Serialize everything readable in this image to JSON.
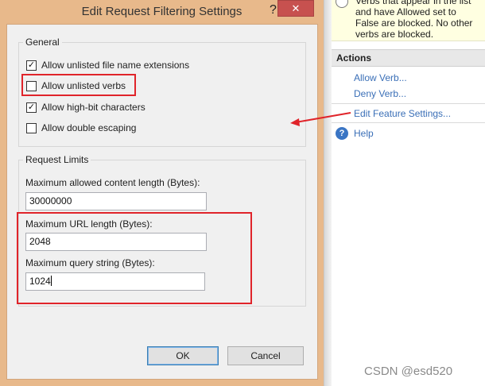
{
  "dialog": {
    "title": "Edit Request Filtering Settings",
    "help_glyph": "?",
    "close_glyph": "✕",
    "general": {
      "legend": "General",
      "options": [
        {
          "label": "Allow unlisted file name extensions",
          "checked": true
        },
        {
          "label": "Allow unlisted verbs",
          "checked": false
        },
        {
          "label": "Allow high-bit characters",
          "checked": true
        },
        {
          "label": "Allow double escaping",
          "checked": false
        }
      ]
    },
    "limits": {
      "legend": "Request Limits",
      "content_length_label": "Maximum allowed content length (Bytes):",
      "content_length_value": "30000000",
      "url_length_label": "Maximum URL length (Bytes):",
      "url_length_value": "2048",
      "query_string_label": "Maximum query string (Bytes):",
      "query_string_value": "1024"
    },
    "buttons": {
      "ok": "OK",
      "cancel": "Cancel"
    }
  },
  "pane": {
    "tip_lines": [
      "Verbs that appear in the list",
      "and have Allowed set to",
      "False are blocked. No other",
      "verbs are blocked."
    ],
    "actions_header": "Actions",
    "links": {
      "allow_verb": "Allow Verb...",
      "deny_verb": "Deny Verb...",
      "edit_feature_settings": "Edit Feature Settings...",
      "help": "Help"
    }
  },
  "watermark": "CSDN @esd520",
  "colors": {
    "highlight": "#e0242a",
    "link": "#3a6fb7",
    "titlebar": "#e8b98b",
    "close": "#c7514f"
  }
}
